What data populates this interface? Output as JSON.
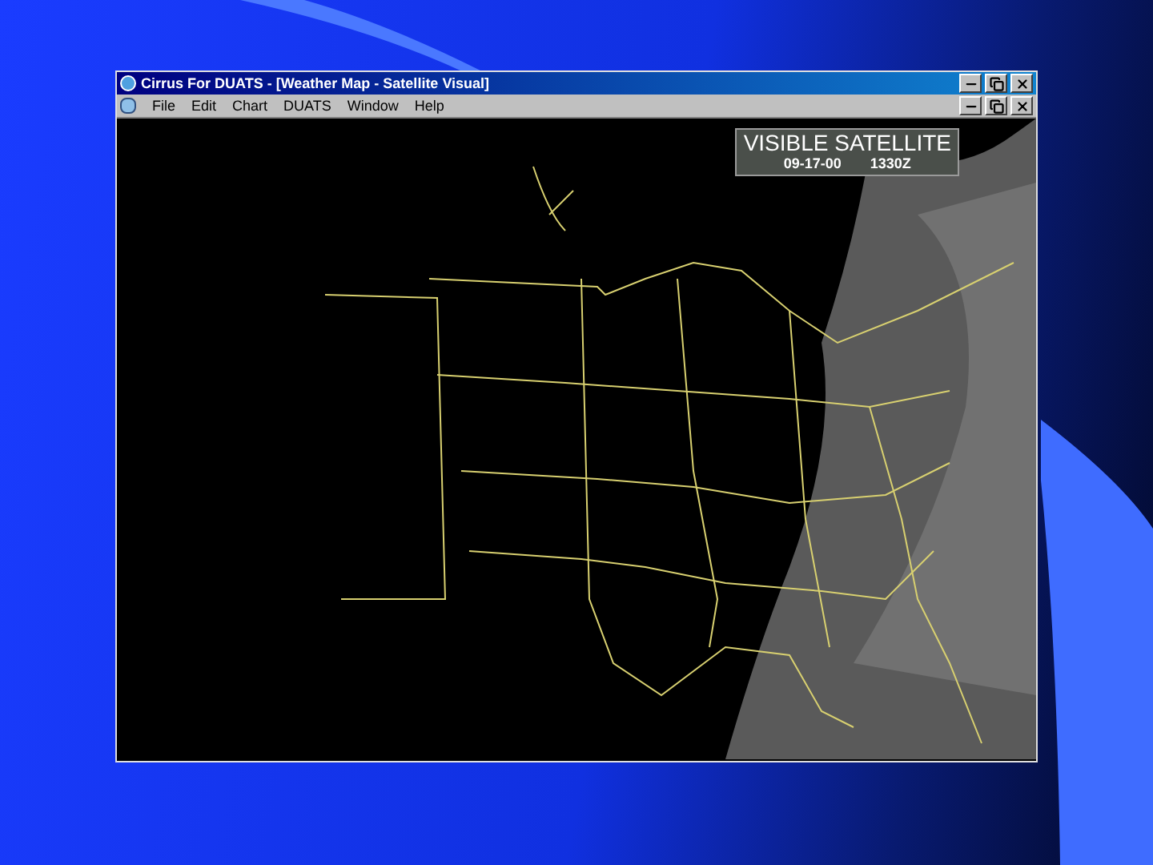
{
  "window": {
    "title": "Cirrus For DUATS - [Weather Map - Satellite Visual]"
  },
  "menu": [
    "File",
    "Edit",
    "Chart",
    "DUATS",
    "Window",
    "Help"
  ],
  "map": {
    "label": "VISIBLE SATELLITE",
    "date": "09-17-00",
    "time": "1330Z"
  }
}
